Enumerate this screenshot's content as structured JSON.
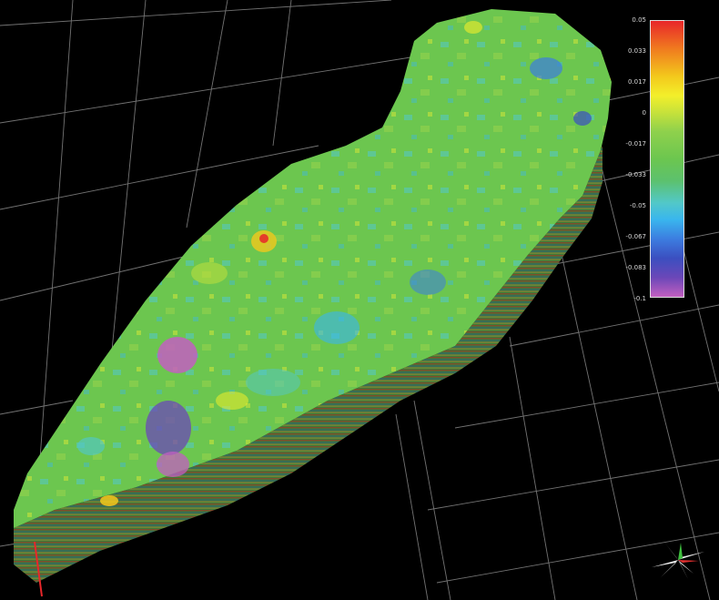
{
  "legend": {
    "ticks": [
      "0.05",
      "0.033",
      "0.017",
      "0",
      "-0.017",
      "-0.033",
      "-0.05",
      "-0.067",
      "-0.083",
      "-0.1"
    ]
  },
  "icons": {
    "compass": "orientation-compass-icon"
  },
  "colors": {
    "background": "#000000",
    "grid": "#9a9a9a",
    "surface_main": "#6cc64f",
    "surface_low": "#c25fc0",
    "surface_high": "#e8262a"
  }
}
